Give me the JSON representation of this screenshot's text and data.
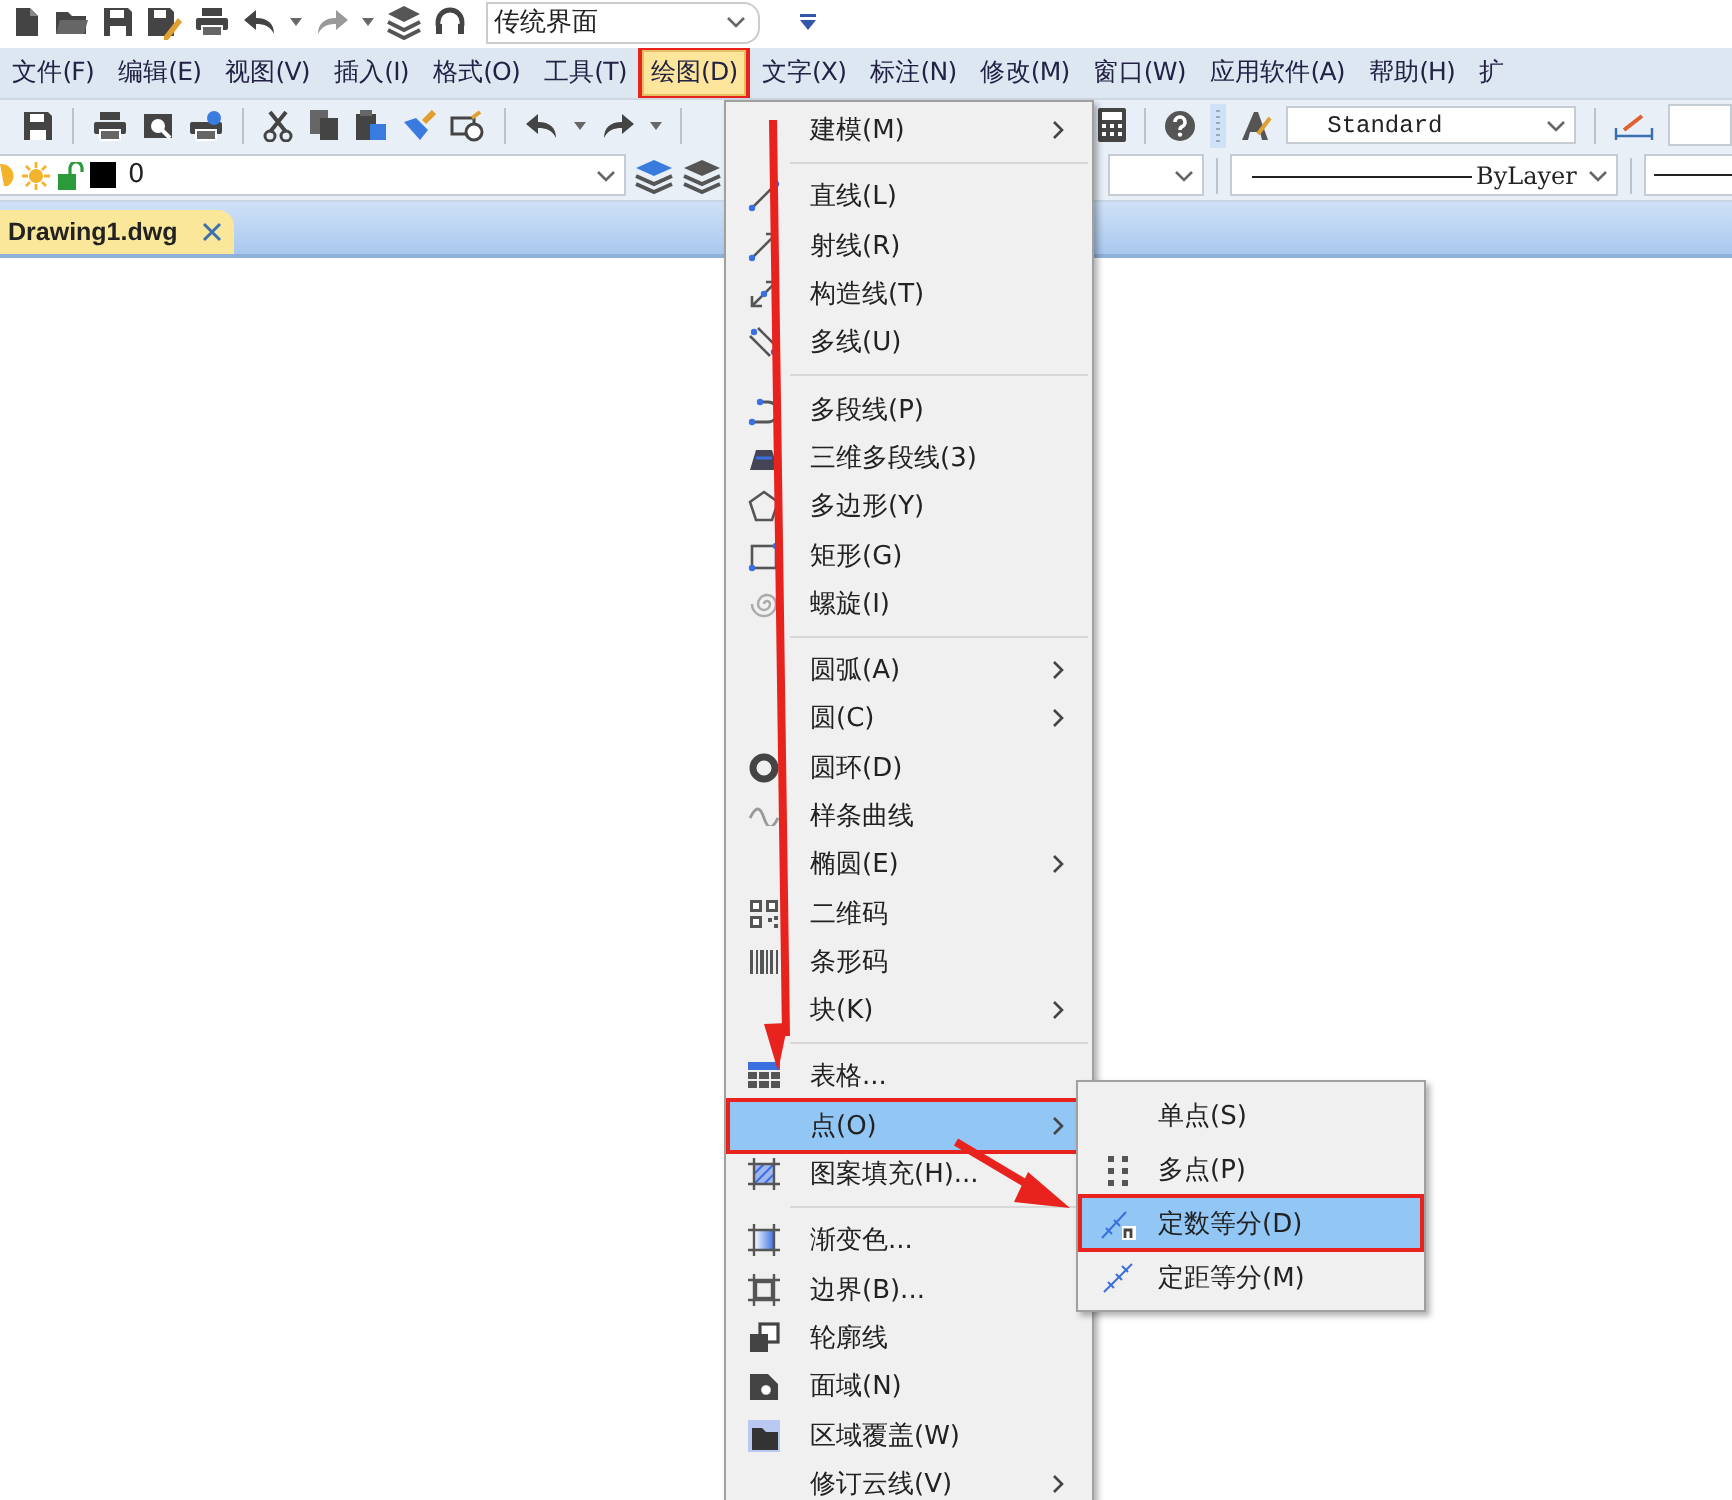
{
  "quick_access": {
    "workspace": "传统界面"
  },
  "menubar": [
    {
      "label": "文件(F)",
      "selected": false,
      "framed": false
    },
    {
      "label": "编辑(E)",
      "selected": false,
      "framed": false
    },
    {
      "label": "视图(V)",
      "selected": false,
      "framed": false
    },
    {
      "label": "插入(I)",
      "selected": false,
      "framed": false
    },
    {
      "label": "格式(O)",
      "selected": false,
      "framed": false
    },
    {
      "label": "工具(T)",
      "selected": false,
      "framed": false
    },
    {
      "label": "绘图(D)",
      "selected": true,
      "framed": true
    },
    {
      "label": "文字(X)",
      "selected": false,
      "framed": false
    },
    {
      "label": "标注(N)",
      "selected": false,
      "framed": false
    },
    {
      "label": "修改(M)",
      "selected": false,
      "framed": false
    },
    {
      "label": "窗口(W)",
      "selected": false,
      "framed": false
    },
    {
      "label": "应用软件(A)",
      "selected": false,
      "framed": false
    },
    {
      "label": "帮助(H)",
      "selected": false,
      "framed": false
    },
    {
      "label": "扩",
      "selected": false,
      "framed": false
    }
  ],
  "toolbar": {
    "text_style": "Standard",
    "layer": "0",
    "linetype": "ByLayer"
  },
  "tabs": [
    {
      "label": "Drawing1.dwg",
      "selected": true
    }
  ],
  "draw_menu": {
    "groups": [
      [
        {
          "label": "建模(M)",
          "has_submenu": true,
          "selected": false,
          "framed": false
        }
      ],
      [
        {
          "label": "直线(L)",
          "has_submenu": false,
          "selected": false,
          "framed": false
        },
        {
          "label": "射线(R)",
          "has_submenu": false,
          "selected": false,
          "framed": false
        },
        {
          "label": "构造线(T)",
          "has_submenu": false,
          "selected": false,
          "framed": false
        },
        {
          "label": "多线(U)",
          "has_submenu": false,
          "selected": false,
          "framed": false
        }
      ],
      [
        {
          "label": "多段线(P)",
          "has_submenu": false,
          "selected": false,
          "framed": false
        },
        {
          "label": "三维多段线(3)",
          "has_submenu": false,
          "selected": false,
          "framed": false
        },
        {
          "label": "多边形(Y)",
          "has_submenu": false,
          "selected": false,
          "framed": false
        },
        {
          "label": "矩形(G)",
          "has_submenu": false,
          "selected": false,
          "framed": false
        },
        {
          "label": "螺旋(I)",
          "has_submenu": false,
          "selected": false,
          "framed": false
        }
      ],
      [
        {
          "label": "圆弧(A)",
          "has_submenu": true,
          "selected": false,
          "framed": false
        },
        {
          "label": "圆(C)",
          "has_submenu": true,
          "selected": false,
          "framed": false
        },
        {
          "label": "圆环(D)",
          "has_submenu": false,
          "selected": false,
          "framed": false
        },
        {
          "label": "样条曲线",
          "has_submenu": false,
          "selected": false,
          "framed": false
        },
        {
          "label": "椭圆(E)",
          "has_submenu": true,
          "selected": false,
          "framed": false
        },
        {
          "label": "二维码",
          "has_submenu": false,
          "selected": false,
          "framed": false
        },
        {
          "label": "条形码",
          "has_submenu": false,
          "selected": false,
          "framed": false
        },
        {
          "label": "块(K)",
          "has_submenu": true,
          "selected": false,
          "framed": false
        }
      ],
      [
        {
          "label": "表格...",
          "has_submenu": false,
          "selected": false,
          "framed": false
        },
        {
          "label": "点(O)",
          "has_submenu": true,
          "selected": true,
          "framed": true
        },
        {
          "label": "图案填充(H)...",
          "has_submenu": false,
          "selected": false,
          "framed": false
        }
      ],
      [
        {
          "label": "渐变色...",
          "has_submenu": false,
          "selected": false,
          "framed": false
        },
        {
          "label": "边界(B)...",
          "has_submenu": false,
          "selected": false,
          "framed": false
        },
        {
          "label": "轮廓线",
          "has_submenu": false,
          "selected": false,
          "framed": false
        },
        {
          "label": "面域(N)",
          "has_submenu": false,
          "selected": false,
          "framed": false
        },
        {
          "label": "区域覆盖(W)",
          "has_submenu": false,
          "selected": false,
          "framed": false
        },
        {
          "label": "修订云线(V)",
          "has_submenu": true,
          "selected": false,
          "framed": false
        }
      ]
    ]
  },
  "point_submenu": [
    {
      "label": "单点(S)",
      "selected": false,
      "framed": false
    },
    {
      "label": "多点(P)",
      "selected": false,
      "framed": false
    },
    {
      "label": "定数等分(D)",
      "selected": true,
      "framed": true
    },
    {
      "label": "定距等分(M)",
      "selected": false,
      "framed": false
    }
  ]
}
